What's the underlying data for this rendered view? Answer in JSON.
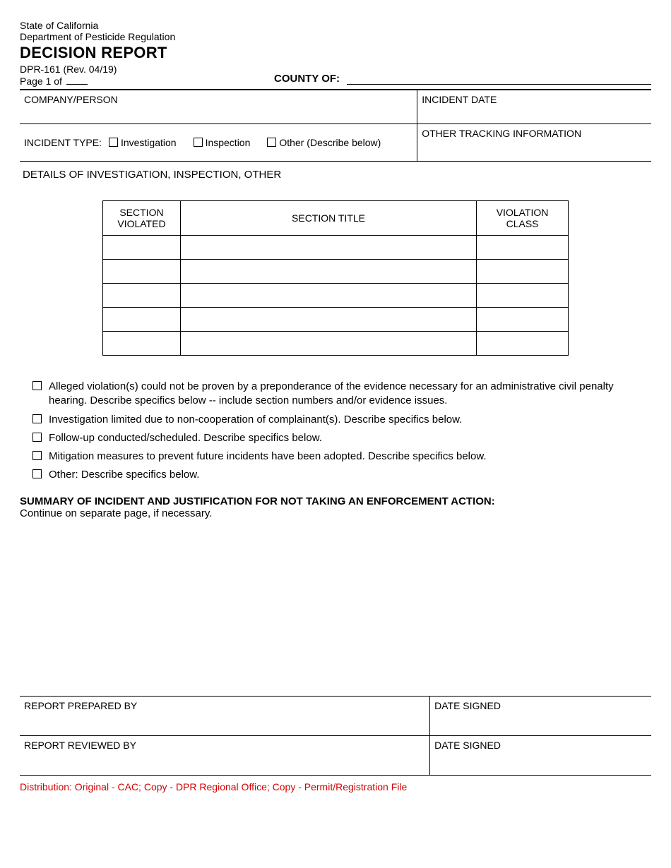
{
  "header": {
    "state_line": "State of California",
    "dept_line": "Department of Pesticide Regulation",
    "title": "DECISION REPORT",
    "form_id": "DPR-161 (Rev. 04/19)",
    "page_label_prefix": "Page 1 of",
    "county_label": "COUNTY OF:"
  },
  "fields": {
    "company_person_label": "COMPANY/PERSON",
    "incident_date_label": "INCIDENT DATE",
    "incident_type_label": "INCIDENT TYPE:",
    "other_tracking_label": "OTHER TRACKING INFORMATION",
    "details_header": "DETAILS OF INVESTIGATION, INSPECTION, OTHER"
  },
  "incident_types": [
    {
      "label": "Investigation"
    },
    {
      "label": "Inspection"
    },
    {
      "label": "Other (Describe below)"
    }
  ],
  "violations_table": {
    "headers": {
      "section_violated": "SECTION VIOLATED",
      "section_title": "SECTION TITLE",
      "violation_class": "VIOLATION CLASS"
    },
    "row_count": 5
  },
  "findings_checks": [
    "Alleged violation(s) could not be proven by a preponderance of the evidence necessary for an administrative civil penalty hearing. Describe specifics below -- include section numbers and/or evidence issues.",
    "Investigation limited due to non-cooperation of complainant(s). Describe specifics below.",
    "Follow-up conducted/scheduled. Describe specifics below.",
    "Mitigation measures to prevent future incidents have been adopted. Describe specifics below.",
    "Other: Describe specifics below."
  ],
  "summary": {
    "heading": "SUMMARY OF INCIDENT AND JUSTIFICATION FOR NOT TAKING AN ENFORCEMENT ACTION:",
    "subtext": "Continue on separate page, if necessary."
  },
  "signatures": {
    "prepared_by_label": "REPORT PREPARED BY",
    "reviewed_by_label": "REPORT REVIEWED BY",
    "date_signed_label": "DATE SIGNED"
  },
  "distribution": "Distribution: Original - CAC; Copy - DPR Regional Office; Copy - Permit/Registration File"
}
